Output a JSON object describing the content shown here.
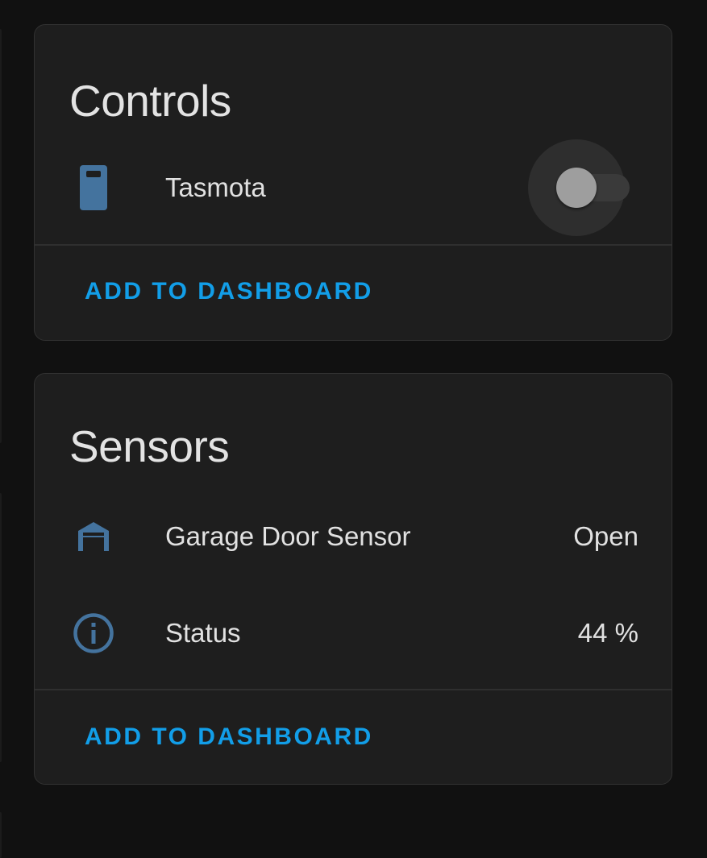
{
  "colors": {
    "background": "#111111",
    "card": "#1e1e1e",
    "icon": "#44739e",
    "action": "#129ee8",
    "text": "#e1e1e1"
  },
  "controls": {
    "title": "Controls",
    "entities": [
      {
        "icon": "remote-icon",
        "name": "Tasmota",
        "toggle_on": false
      }
    ],
    "action_label": "ADD TO DASHBOARD"
  },
  "sensors": {
    "title": "Sensors",
    "entities": [
      {
        "icon": "garage-open-icon",
        "name": "Garage Door Sensor",
        "state": "Open"
      },
      {
        "icon": "information-outline-icon",
        "name": "Status",
        "state": "44 %"
      }
    ],
    "action_label": "ADD TO DASHBOARD"
  }
}
